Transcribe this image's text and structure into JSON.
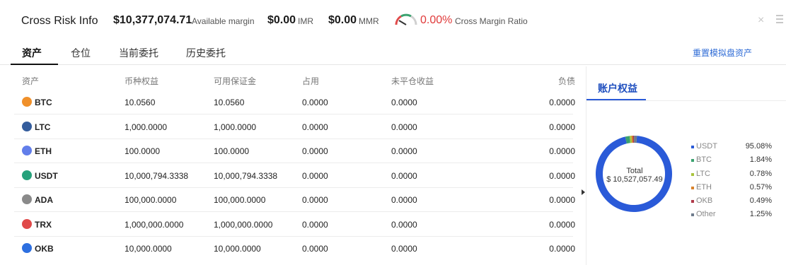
{
  "header": {
    "title": "Cross Risk Info",
    "available_margin_value": "$10,377,074.71",
    "available_margin_label": "Available margin",
    "imr_value": "$0.00",
    "imr_label": "IMR",
    "mmr_value": "$0.00",
    "mmr_label": "MMR",
    "ratio_value": "0.00%",
    "ratio_label": "Cross Margin Ratio",
    "close_icon": "close-icon",
    "menu_icon": "menu-icon"
  },
  "tabs": [
    {
      "label": "资产",
      "active": true
    },
    {
      "label": "仓位",
      "active": false
    },
    {
      "label": "当前委托",
      "active": false
    },
    {
      "label": "历史委托",
      "active": false
    }
  ],
  "reset_link": "重置模拟盘资产",
  "table": {
    "columns": [
      "资产",
      "币种权益",
      "可用保证金",
      "占用",
      "未平仓收益",
      "负债"
    ],
    "rows": [
      {
        "symbol": "BTC",
        "icon": "btc-icon",
        "color": "#f0902a",
        "equity": "10.0560",
        "available": "10.0560",
        "occupied": "0.0000",
        "unrealized": "0.0000",
        "liability": "0.0000"
      },
      {
        "symbol": "LTC",
        "icon": "ltc-icon",
        "color": "#345d9d",
        "equity": "1,000.0000",
        "available": "1,000.0000",
        "occupied": "0.0000",
        "unrealized": "0.0000",
        "liability": "0.0000"
      },
      {
        "symbol": "ETH",
        "icon": "eth-icon",
        "color": "#627eea",
        "equity": "100.0000",
        "available": "100.0000",
        "occupied": "0.0000",
        "unrealized": "0.0000",
        "liability": "0.0000"
      },
      {
        "symbol": "USDT",
        "icon": "usdt-icon",
        "color": "#26a17b",
        "equity": "10,000,794.3338",
        "available": "10,000,794.3338",
        "occupied": "0.0000",
        "unrealized": "0.0000",
        "liability": "0.0000"
      },
      {
        "symbol": "ADA",
        "icon": "ada-icon",
        "color": "#8a8a8a",
        "equity": "100,000.0000",
        "available": "100,000.0000",
        "occupied": "0.0000",
        "unrealized": "0.0000",
        "liability": "0.0000"
      },
      {
        "symbol": "TRX",
        "icon": "trx-icon",
        "color": "#e04a4a",
        "equity": "1,000,000.0000",
        "available": "1,000,000.0000",
        "occupied": "0.0000",
        "unrealized": "0.0000",
        "liability": "0.0000"
      },
      {
        "symbol": "OKB",
        "icon": "okb-icon",
        "color": "#2d6fe0",
        "equity": "10,000.0000",
        "available": "10,000.0000",
        "occupied": "0.0000",
        "unrealized": "0.0000",
        "liability": "0.0000"
      }
    ]
  },
  "right_panel": {
    "tab_label": "账户权益",
    "total_label": "Total",
    "total_value": "$ 10,527,057.49"
  },
  "chart_data": {
    "type": "pie",
    "title": "",
    "slices": [
      {
        "name": "USDT",
        "value": 95.08,
        "color": "#2a5ad8",
        "label": "95.08%"
      },
      {
        "name": "BTC",
        "value": 1.84,
        "color": "#3aa26f",
        "label": "1.84%"
      },
      {
        "name": "LTC",
        "value": 0.78,
        "color": "#a9c43d",
        "label": "0.78%"
      },
      {
        "name": "ETH",
        "value": 0.57,
        "color": "#d9822b",
        "label": "0.57%"
      },
      {
        "name": "OKB",
        "value": 0.49,
        "color": "#b03a4a",
        "label": "0.49%"
      },
      {
        "name": "Other",
        "value": 1.25,
        "color": "#6e7b8c",
        "label": "1.25%"
      }
    ],
    "legend_position": "right",
    "donut": true
  }
}
